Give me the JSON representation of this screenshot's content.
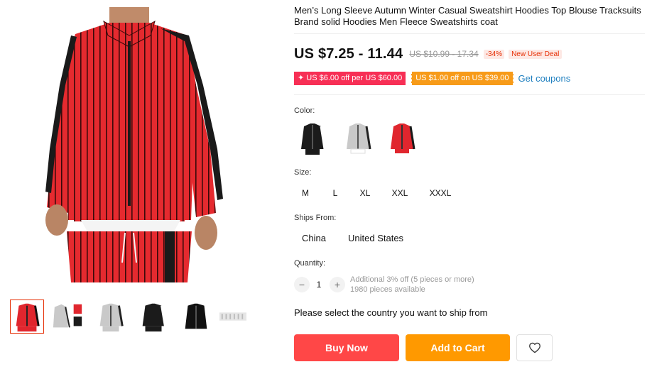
{
  "product": {
    "title": "Men’s Long Sleeve Autumn Winter Casual Sweatshirt Hoodies Top Blouse Tracksuits Brand solid Hoodies Men Fleece Sweatshirts coat"
  },
  "price": {
    "current": "US $7.25 - 11.44",
    "original": "US $10.99 - 17.34",
    "discount": "-34%",
    "deal": "New User Deal"
  },
  "coupons": {
    "items": [
      "✦ US $6.00 off per US $60.00",
      "US $1.00 off on US $39.00"
    ],
    "get_label": "Get coupons"
  },
  "color": {
    "label": "Color:",
    "options": [
      {
        "name": "black-white-sleeve",
        "body": "#1b1b1b",
        "stripe": "#ffffff"
      },
      {
        "name": "grey-black-sleeve",
        "body": "#c9c9c9",
        "stripe": "#222222"
      },
      {
        "name": "red-black-sleeve",
        "body": "#e0262e",
        "stripe": "#1a1a1a"
      }
    ]
  },
  "size": {
    "label": "Size:",
    "options": [
      "M",
      "L",
      "XL",
      "XXL",
      "XXXL"
    ]
  },
  "ships_from": {
    "label": "Ships From:",
    "options": [
      "China",
      "United States"
    ]
  },
  "quantity": {
    "label": "Quantity:",
    "minus": "−",
    "plus": "+",
    "value": "1",
    "note1": "Additional 3% off (5 pieces or more)",
    "note2": "1980 pieces available"
  },
  "shipping_message": "Please select the country you want to ship from",
  "buttons": {
    "buy_now": "Buy Now",
    "add_to_cart": "Add to Cart"
  },
  "colors": {
    "accent_red": "#ff4747",
    "accent_orange": "#ff9900",
    "price_red": "#e62e04",
    "link_blue": "#2080c0"
  }
}
